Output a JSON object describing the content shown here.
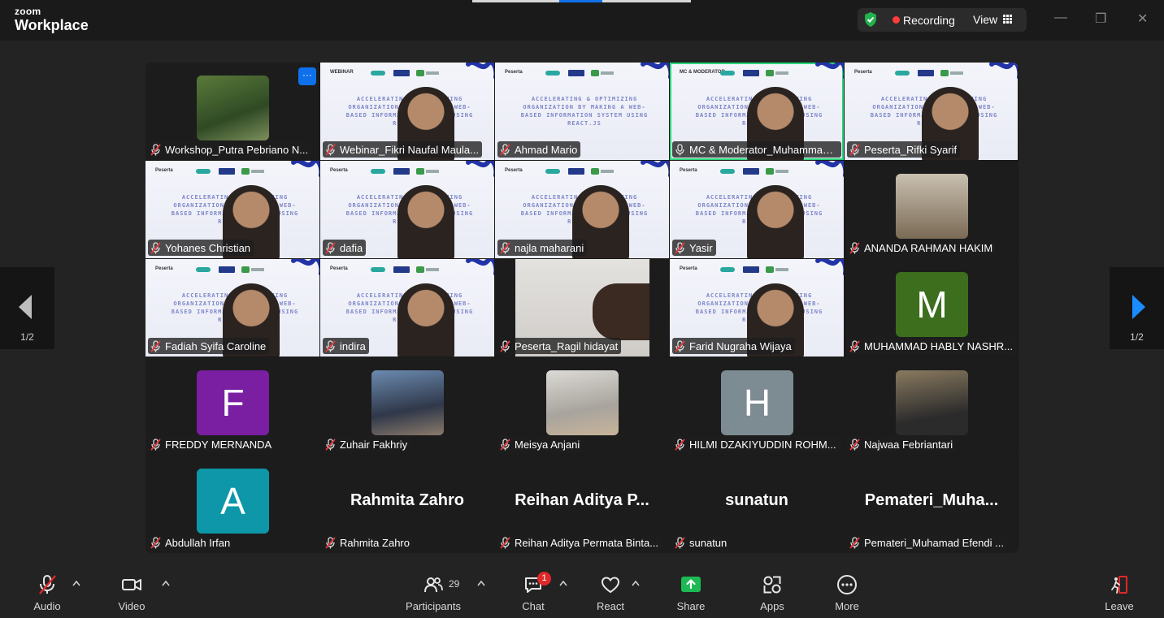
{
  "app": {
    "logo_line1": "zoom",
    "logo_line2": "Workplace"
  },
  "topbar": {
    "recording_label": "Recording",
    "view_label": "View"
  },
  "colors": {
    "accent_blue": "#0e71eb",
    "recording_red": "#ff3b3b",
    "active_speaker": "#29d67a",
    "share_green": "#1db954",
    "badge_red": "#e02828"
  },
  "navigation": {
    "prev_page": "1/2",
    "next_page": "1/2"
  },
  "slide": {
    "title": "ACCELERATING & OPTIMIZING ORGANIZATION BY MAKING A WEB-BASED INFORMATION SYSTEM USING REACT.JS"
  },
  "participants": [
    {
      "name": "Workshop_Putra Pebriano N...",
      "kind": "photo",
      "tag": "",
      "muted": true
    },
    {
      "name": "Webinar_Fikri Naufal Maula...",
      "kind": "slide",
      "tag": "WEBINAR",
      "muted": true
    },
    {
      "name": "Ahmad Mario",
      "kind": "slide",
      "tag": "Peserta",
      "muted": true
    },
    {
      "name": "MC & Moderator_Muhammad ...",
      "kind": "slide",
      "tag": "MC & MODERATOR",
      "muted": false,
      "active": true
    },
    {
      "name": "Peserta_Rifki Syarif",
      "kind": "slide",
      "tag": "Peserta",
      "muted": true
    },
    {
      "name": "Yohanes Christian",
      "kind": "slide",
      "tag": "Peserta",
      "muted": true
    },
    {
      "name": "dafia",
      "kind": "slide",
      "tag": "Peserta",
      "muted": true
    },
    {
      "name": "najla maharani",
      "kind": "slide",
      "tag": "Peserta",
      "muted": true
    },
    {
      "name": "Yasir",
      "kind": "slide",
      "tag": "Peserta",
      "muted": true
    },
    {
      "name": "ANANDA RAHMAN HAKIM",
      "kind": "photo",
      "tag": "",
      "muted": true
    },
    {
      "name": "Fadiah Syifa Caroline",
      "kind": "slide",
      "tag": "Peserta",
      "muted": true
    },
    {
      "name": "indira",
      "kind": "slide",
      "tag": "Peserta",
      "muted": true
    },
    {
      "name": "Peserta_Ragil hidayat",
      "kind": "camera",
      "tag": "",
      "muted": true
    },
    {
      "name": "Farid Nugraha Wijaya",
      "kind": "slide",
      "tag": "Peserta",
      "muted": true
    },
    {
      "name": "MUHAMMAD HABLY NASHR...",
      "kind": "letter",
      "letter": "M",
      "color": "#3c6e1e",
      "muted": true
    },
    {
      "name": "FREDDY MERNANDA",
      "kind": "letter",
      "letter": "F",
      "color": "#7b1fa2",
      "muted": true
    },
    {
      "name": "Zuhair Fakhriy",
      "kind": "photo",
      "tag": "",
      "muted": true
    },
    {
      "name": "Meisya Anjani",
      "kind": "photo",
      "tag": "",
      "muted": true
    },
    {
      "name": "HILMI DZAKIYUDDIN ROHM...",
      "kind": "letter",
      "letter": "H",
      "color": "#7d8b93",
      "muted": true
    },
    {
      "name": "Najwaa Febriantari",
      "kind": "photo",
      "tag": "",
      "muted": true
    },
    {
      "name": "Abdullah Irfan",
      "kind": "letter",
      "letter": "A",
      "color": "#0e97a8",
      "muted": true
    },
    {
      "name": "Rahmita Zahro",
      "kind": "text",
      "display": "Rahmita Zahro",
      "muted": true
    },
    {
      "name": "Reihan Aditya Permata Binta...",
      "kind": "text",
      "display": "Reihan  Aditya  P...",
      "muted": true
    },
    {
      "name": "sunatun",
      "kind": "text",
      "display": "sunatun",
      "muted": true
    },
    {
      "name": "Pemateri_Muhamad Efendi ...",
      "kind": "text",
      "display": "Pemateri_Muha...",
      "muted": true
    }
  ],
  "toolbar": {
    "audio": "Audio",
    "video": "Video",
    "participants": "Participants",
    "participants_count": "29",
    "chat": "Chat",
    "chat_badge": "1",
    "react": "React",
    "share": "Share",
    "apps": "Apps",
    "more": "More",
    "leave": "Leave"
  }
}
